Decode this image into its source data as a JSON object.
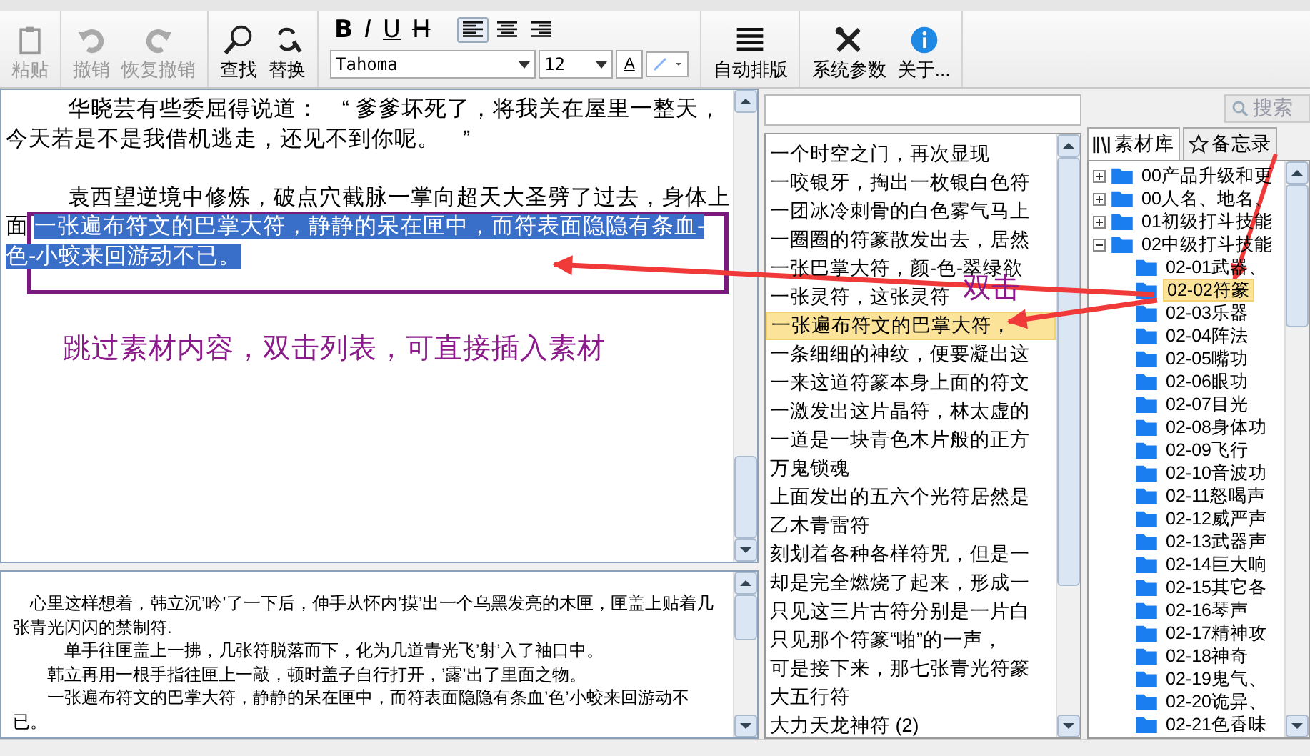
{
  "toolbar": {
    "groups": [
      {
        "kind": "buttons",
        "items": [
          {
            "label": "粘贴",
            "disabled": true
          }
        ]
      },
      {
        "kind": "buttons",
        "items": [
          {
            "label": "撤销",
            "disabled": true
          },
          {
            "label": "恢复撤销",
            "disabled": true
          }
        ]
      },
      {
        "kind": "buttons",
        "items": [
          {
            "label": "查找",
            "disabled": false
          },
          {
            "label": "替换",
            "disabled": false
          }
        ]
      },
      {
        "kind": "format",
        "styles": [
          "B",
          "I",
          "U",
          "H"
        ],
        "aligns": [
          {
            "selected": true
          },
          {
            "selected": false
          },
          {
            "selected": false
          }
        ],
        "font": "Tahoma",
        "size": "12",
        "color_label": "A"
      },
      {
        "kind": "buttons",
        "items": [
          {
            "label": "自动排版",
            "disabled": false
          }
        ]
      },
      {
        "kind": "buttons",
        "items": [
          {
            "label": "系统参数",
            "disabled": false
          },
          {
            "label": "关于...",
            "disabled": false
          }
        ]
      }
    ]
  },
  "editor": {
    "paragraphs": [
      {
        "text": "华晓芸有些委屈得说道：　“ 爹爹坏死了，将我关在屋里一整天，今天若是不是我借机逃走，还见不到你呢。　”"
      },
      {
        "lines": [
          {
            "text": "袁西望逆境中修炼，破点穴截脉一掌向超天大圣劈了过去，身体上"
          },
          {
            "text": "面",
            "selected_text": "一张遍布符文的巴掌大符，静静的呆在匣中，而符表面隐隐有条血-"
          },
          {
            "selected_text": "色-小蛟来回游动不已。"
          }
        ]
      }
    ]
  },
  "preview": {
    "lines": [
      "　心里这样想着，韩立沉’吟’了一下后，伸手从怀内’摸’出一个乌黑发亮的木匣，匣盖上贴着几张青光闪闪的禁制符.",
      "　　　单手往匣盖上一拂，几张符脱落而下，化为几道青光飞’射’入了袖口中。",
      "　　韩立再用一根手指往匣上一敲，顿时盖子自行打开，’露’出了里面之物。",
      "　　一张遍布符文的巴掌大符，静静的呆在匣中，而符表面隐隐有条血’色’小蛟来回游动不已。"
    ]
  },
  "material_list": {
    "search_button": "搜索",
    "items": [
      {
        "text": "一个时空之门，再次显现",
        "selected": false
      },
      {
        "text": "一咬银牙，掏出一枚银白色符",
        "selected": false
      },
      {
        "text": "一团冰冷刺骨的白色雾气马上",
        "selected": false
      },
      {
        "text": "一圈圈的符篆散发出去，居然",
        "selected": false
      },
      {
        "text": "一张巴掌大符，颜-色-翠绿欲",
        "selected": false
      },
      {
        "text": "一张灵符，这张灵符",
        "selected": false
      },
      {
        "text": "一张遍布符文的巴掌大符，",
        "selected": true
      },
      {
        "text": "一条细细的神纹，便要凝出这",
        "selected": false
      },
      {
        "text": "一来这道符篆本身上面的符文",
        "selected": false
      },
      {
        "text": "一激发出这片晶符，林太虚的",
        "selected": false
      },
      {
        "text": "一道是一块青色木片般的正方",
        "selected": false
      },
      {
        "text": "万鬼锁魂",
        "selected": false
      },
      {
        "text": "上面发出的五六个光符居然是",
        "selected": false
      },
      {
        "text": "乙木青雷符",
        "selected": false
      },
      {
        "text": "刻划着各种各样符咒，但是一",
        "selected": false
      },
      {
        "text": "却是完全燃烧了起来，形成一",
        "selected": false
      },
      {
        "text": "只见这三片古符分别是一片白",
        "selected": false
      },
      {
        "text": "只见那个符篆“啪”的一声，",
        "selected": false
      },
      {
        "text": "可是接下来，那七张青光符篆",
        "selected": false
      },
      {
        "text": "大五行符",
        "selected": false
      },
      {
        "text": "大力天龙神符 (2)",
        "selected": false
      }
    ]
  },
  "library": {
    "tabs": [
      {
        "label": "素材库",
        "selected": true
      },
      {
        "label": "备忘录",
        "selected": false
      }
    ],
    "tree": [
      {
        "label": "00产品升级和更",
        "expanded": false,
        "selected": false
      },
      {
        "label": "00人名、地名、",
        "expanded": false,
        "selected": false
      },
      {
        "label": "01初级打斗技能",
        "expanded": false,
        "selected": false
      },
      {
        "label": "02中级打斗技能",
        "expanded": true,
        "selected": false,
        "children": [
          {
            "label": "02-01武器、",
            "selected": false
          },
          {
            "label": "02-02符篆",
            "selected": true
          },
          {
            "label": "02-03乐器",
            "selected": false
          },
          {
            "label": "02-04阵法",
            "selected": false
          },
          {
            "label": "02-05嘴功",
            "selected": false
          },
          {
            "label": "02-06眼功",
            "selected": false
          },
          {
            "label": "02-07目光",
            "selected": false
          },
          {
            "label": "02-08身体功",
            "selected": false
          },
          {
            "label": "02-09飞行",
            "selected": false
          },
          {
            "label": "02-10音波功",
            "selected": false
          },
          {
            "label": "02-11怒喝声",
            "selected": false
          },
          {
            "label": "02-12威严声",
            "selected": false
          },
          {
            "label": "02-13武器声",
            "selected": false
          },
          {
            "label": "02-14巨大响",
            "selected": false
          },
          {
            "label": "02-15其它各",
            "selected": false
          },
          {
            "label": "02-16琴声",
            "selected": false
          },
          {
            "label": "02-17精神攻",
            "selected": false
          },
          {
            "label": "02-18神奇",
            "selected": false
          },
          {
            "label": "02-19鬼气、",
            "selected": false
          },
          {
            "label": "02-20诡异、",
            "selected": false
          },
          {
            "label": "02-21色香味",
            "selected": false
          }
        ]
      }
    ]
  },
  "annotations": {
    "instruction": "跳过素材内容，双击列表，可直接插入素材",
    "double_click": "双击"
  }
}
